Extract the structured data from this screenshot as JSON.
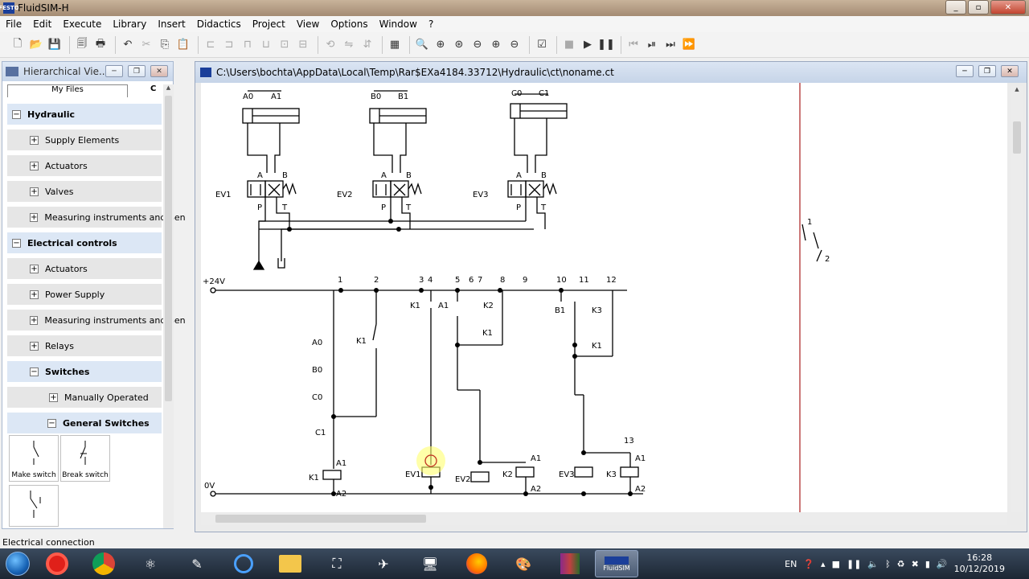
{
  "app": {
    "title": "FluidSIM-H",
    "logo_text": "FESTO"
  },
  "menu": [
    "File",
    "Edit",
    "Execute",
    "Library",
    "Insert",
    "Didactics",
    "Project",
    "View",
    "Options",
    "Window",
    "?"
  ],
  "library": {
    "title": "Hierarchical Vie...",
    "tab1": "My Files",
    "tab2": "C",
    "tree": [
      {
        "label": "Hydraulic",
        "level": 0
      },
      {
        "label": "Supply Elements",
        "level": 1
      },
      {
        "label": "Actuators",
        "level": 1
      },
      {
        "label": "Valves",
        "level": 1
      },
      {
        "label": "Measuring instruments and Sen",
        "level": 1
      },
      {
        "label": "Electrical controls",
        "level": 0
      },
      {
        "label": "Actuators",
        "level": 1
      },
      {
        "label": "Power Supply",
        "level": 1
      },
      {
        "label": "Measuring instruments and Sen",
        "level": 1
      },
      {
        "label": "Relays",
        "level": 1
      },
      {
        "label": "Switches",
        "level": 1
      },
      {
        "label": "Manually Operated",
        "level": 2
      },
      {
        "label": "General Switches",
        "level": 2
      }
    ],
    "components": [
      "Make switch",
      "Break switch"
    ]
  },
  "drawing": {
    "path": "C:\\Users\\bochta\\AppData\\Local\\Temp\\Rar$EXa4184.33712\\Hydraulic\\ct\\noname.ct",
    "labels": {
      "A0": "A0",
      "A1": "A1",
      "B0": "B0",
      "B1": "B1",
      "C0": "C0",
      "C1": "C1",
      "A": "A",
      "B": "B",
      "P": "P",
      "T": "T",
      "EV1": "EV1",
      "EV2": "EV2",
      "EV3": "EV3",
      "K1": "K1",
      "K2": "K2",
      "K3": "K3",
      "plus24": "+24V",
      "zero": "0V",
      "A2": "A2",
      "n1": "1",
      "n2": "2",
      "n3": "3",
      "n4": "4",
      "n5": "5",
      "n6": "6",
      "n7": "7",
      "n8": "8",
      "n9": "9",
      "n10": "10",
      "n11": "11",
      "n12": "12",
      "n13": "13"
    }
  },
  "status": "Electrical connection",
  "taskbar": {
    "lang": "EN",
    "time": "16:28",
    "date": "10/12/2019",
    "fluidsim_label": "FluidSIM"
  }
}
